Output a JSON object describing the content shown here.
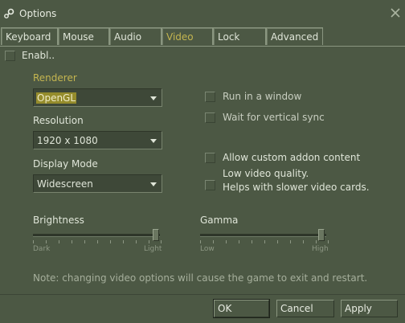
{
  "window": {
    "title": "Options"
  },
  "tabs": [
    {
      "label": "Keyboard"
    },
    {
      "label": "Mouse"
    },
    {
      "label": "Audio"
    },
    {
      "label": "Video",
      "active": true
    },
    {
      "label": "Lock"
    },
    {
      "label": "Advanced"
    }
  ],
  "enable": {
    "label": "Enabl..",
    "checked": false
  },
  "renderer": {
    "label": "Renderer",
    "value": "OpenGL"
  },
  "resolution": {
    "label": "Resolution",
    "value": "1920 x 1080"
  },
  "display_mode": {
    "label": "Display Mode",
    "value": "Widescreen"
  },
  "options": {
    "run_in_window": {
      "label": "Run in a window",
      "checked": false
    },
    "vsync": {
      "label": "Wait for vertical sync",
      "checked": false
    },
    "custom_addon": {
      "label": "Allow custom addon content",
      "checked": false
    },
    "low_quality": {
      "label_line1": "Low video quality.",
      "label_line2": "Helps with slower video cards.",
      "checked": false
    }
  },
  "brightness": {
    "label": "Brightness",
    "min_label": "Dark",
    "max_label": "Light",
    "value": 1.0
  },
  "gamma": {
    "label": "Gamma",
    "min_label": "Low",
    "max_label": "High",
    "value": 1.0
  },
  "note": "Note: changing video options will cause the game to exit and restart.",
  "buttons": {
    "ok": "OK",
    "cancel": "Cancel",
    "apply": "Apply"
  },
  "colors": {
    "background": "#4c5844",
    "accent": "#c4b550",
    "highlight": "#958c2c"
  },
  "icons": {
    "app": "steam-icon",
    "close": "close-icon"
  }
}
